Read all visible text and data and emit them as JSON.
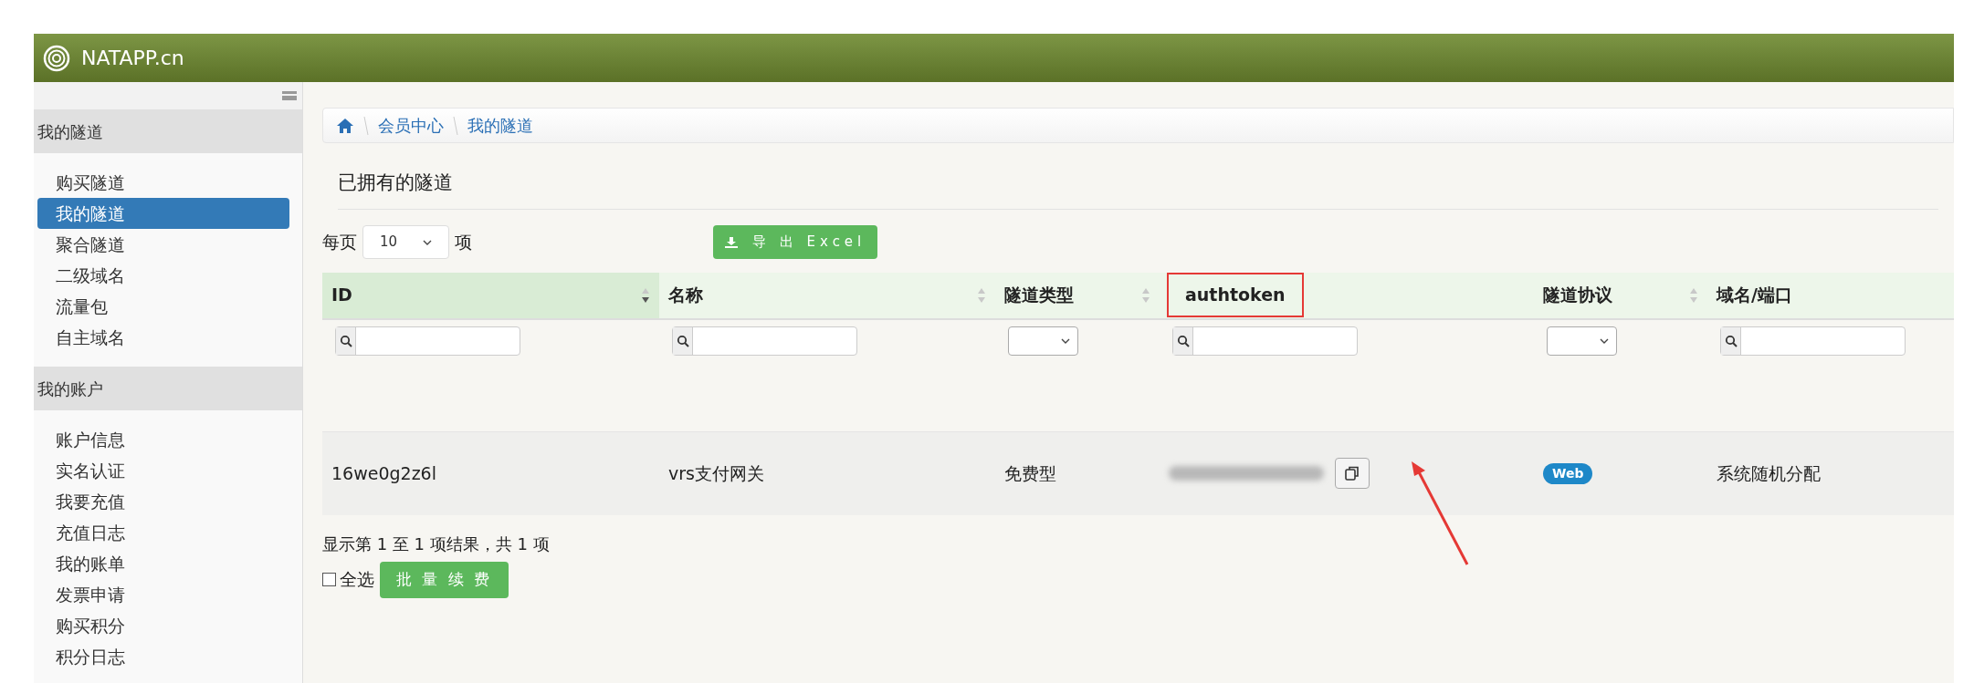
{
  "brand": {
    "name": "NATAPP.cn"
  },
  "sidebar": {
    "sections": [
      {
        "title": "我的隧道",
        "items": [
          {
            "label": "购买隧道",
            "selected": false
          },
          {
            "label": "我的隧道",
            "selected": true
          },
          {
            "label": "聚合隧道",
            "selected": false
          },
          {
            "label": "二级域名",
            "selected": false
          },
          {
            "label": "流量包",
            "selected": false
          },
          {
            "label": "自主域名",
            "selected": false
          }
        ]
      },
      {
        "title": "我的账户",
        "items": [
          {
            "label": "账户信息",
            "selected": false
          },
          {
            "label": "实名认证",
            "selected": false
          },
          {
            "label": "我要充值",
            "selected": false
          },
          {
            "label": "充值日志",
            "selected": false
          },
          {
            "label": "我的账单",
            "selected": false
          },
          {
            "label": "发票申请",
            "selected": false
          },
          {
            "label": "购买积分",
            "selected": false
          },
          {
            "label": "积分日志",
            "selected": false
          }
        ]
      }
    ]
  },
  "breadcrumb": [
    "会员中心",
    "我的隧道"
  ],
  "page_title": "已拥有的隧道",
  "page_size": {
    "prefix": "每页",
    "value": "10",
    "suffix": "项"
  },
  "export_button": "导 出 Excel",
  "table": {
    "columns": [
      {
        "label": "ID",
        "sortable": true,
        "sorted": true,
        "filter": {
          "kind": "search"
        },
        "highlighted": false
      },
      {
        "label": "名称",
        "sortable": true,
        "sorted": false,
        "filter": {
          "kind": "search"
        },
        "highlighted": false
      },
      {
        "label": "隧道类型",
        "sortable": true,
        "sorted": false,
        "filter": {
          "kind": "select"
        },
        "highlighted": false
      },
      {
        "label": "authtoken",
        "sortable": false,
        "sorted": false,
        "filter": {
          "kind": "search"
        },
        "highlighted": true
      },
      {
        "label": "隧道协议",
        "sortable": true,
        "sorted": false,
        "filter": {
          "kind": "select"
        },
        "highlighted": false
      },
      {
        "label": "域名/端口",
        "sortable": false,
        "sorted": false,
        "filter": {
          "kind": "search"
        },
        "highlighted": false
      }
    ],
    "rows": [
      {
        "cells": [
          {
            "kind": "text",
            "text": "16we0g2z6l"
          },
          {
            "kind": "text",
            "text": "vrs支付网关"
          },
          {
            "kind": "text",
            "text": "免费型"
          },
          {
            "kind": "token"
          },
          {
            "kind": "badge",
            "text": "Web"
          },
          {
            "kind": "text",
            "text": "系统随机分配"
          }
        ]
      }
    ]
  },
  "summary": "显示第 1 至 1 项结果，共 1 项",
  "select_all": {
    "label": "全选",
    "checked": false
  },
  "batch_button": "批 量 续 费"
}
